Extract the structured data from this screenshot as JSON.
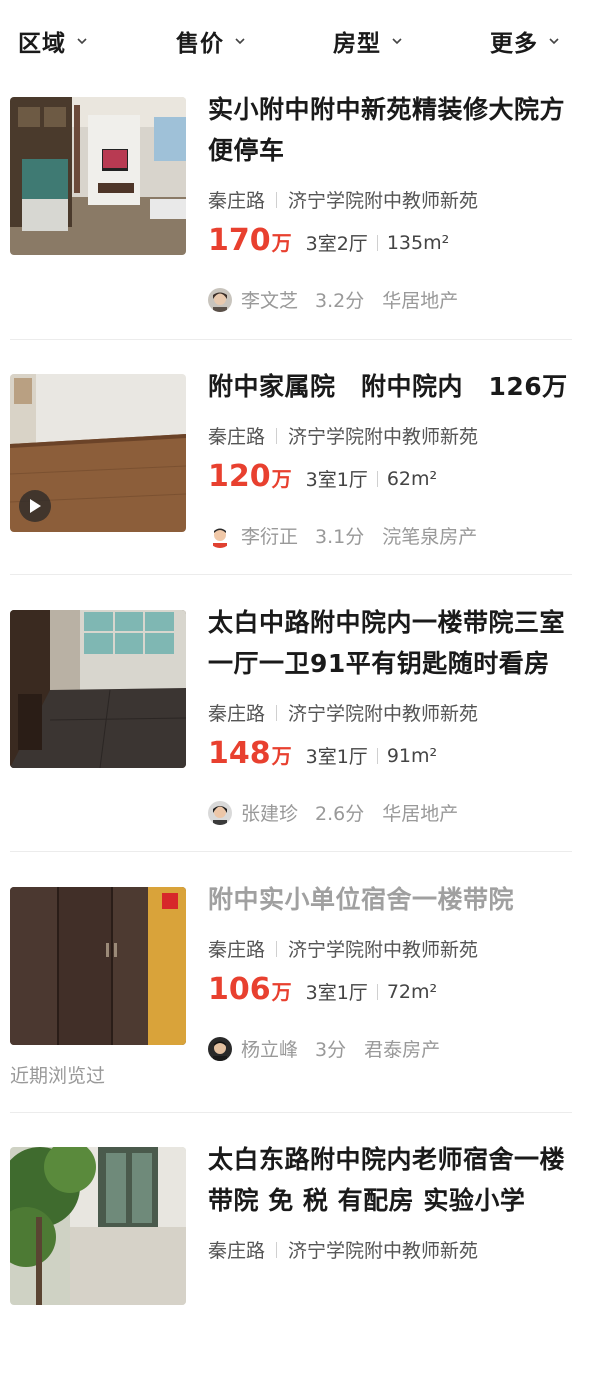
{
  "filters": [
    {
      "label": "区域"
    },
    {
      "label": "售价"
    },
    {
      "label": "房型"
    },
    {
      "label": "更多"
    }
  ],
  "listings": [
    {
      "title": "实小附中附中新苑精装修大院方便停车",
      "district": "秦庄路",
      "community": "济宁学院附中教师新苑",
      "price": "170",
      "price_unit": "万",
      "layout": "3室2厅",
      "area": "135m²",
      "agent": "李文芝",
      "score": "3.2分",
      "company": "华居地产"
    },
    {
      "title": "附中家属院　附中院内　126万",
      "district": "秦庄路",
      "community": "济宁学院附中教师新苑",
      "price": "120",
      "price_unit": "万",
      "layout": "3室1厅",
      "area": "62m²",
      "agent": "李衍正",
      "score": "3.1分",
      "company": "浣笔泉房产"
    },
    {
      "title": "太白中路附中院内一楼带院三室一厅一卫91平有钥匙随时看房",
      "district": "秦庄路",
      "community": "济宁学院附中教师新苑",
      "price": "148",
      "price_unit": "万",
      "layout": "3室1厅",
      "area": "91m²",
      "agent": "张建珍",
      "score": "2.6分",
      "company": "华居地产"
    },
    {
      "title": "附中实小单位宿舍一楼带院",
      "district": "秦庄路",
      "community": "济宁学院附中教师新苑",
      "price": "106",
      "price_unit": "万",
      "layout": "3室1厅",
      "area": "72m²",
      "agent": "杨立峰",
      "score": "3分",
      "company": "君泰房产",
      "visited_label": "近期浏览过"
    },
    {
      "title": "太白东路附中院内老师宿舍一楼带院 免 税 有配房 实验小学",
      "district": "秦庄路",
      "community": "济宁学院附中教师新苑"
    }
  ],
  "colors": {
    "price": "#e8402f",
    "visited_title": "#a0a0a0",
    "meta": "#999999"
  },
  "icons": {
    "filter_dropdown": "chevron-down-icon",
    "video": "play-icon"
  }
}
